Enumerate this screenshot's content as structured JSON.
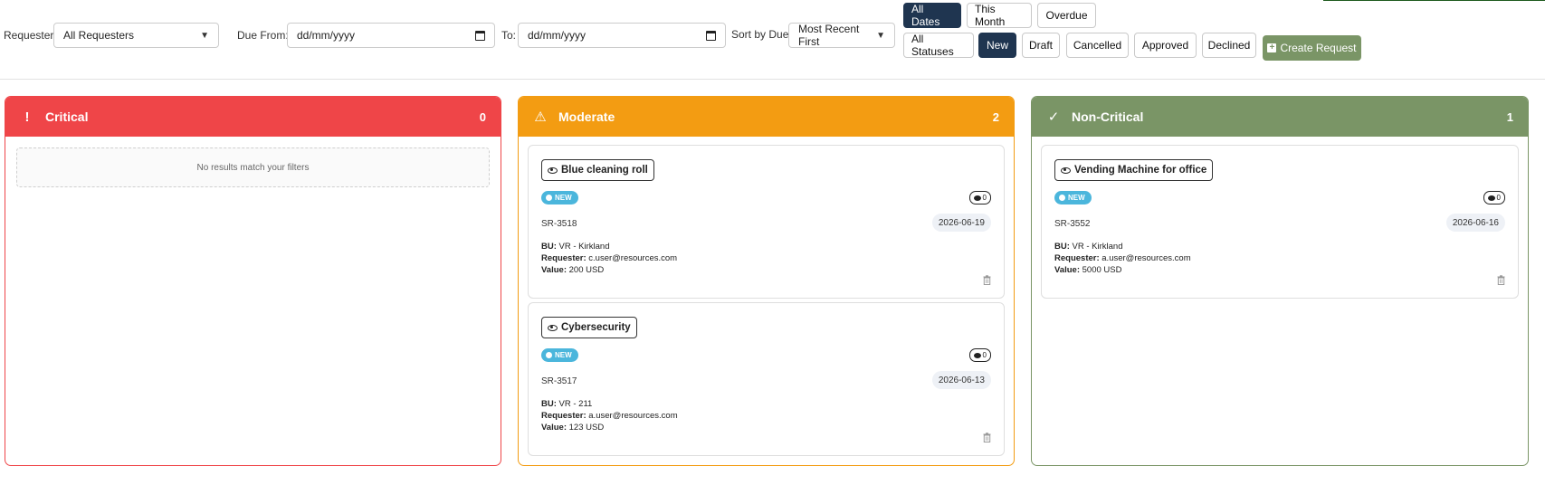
{
  "filters": {
    "requester_label": "Requester:",
    "requester_value": "All Requesters",
    "due_from_label": "Due From:",
    "due_from_placeholder": "dd/mm/yyyy",
    "to_label": "To:",
    "to_placeholder": "dd/mm/yyyy",
    "sort_label": "Sort by Due:",
    "sort_value": "Most Recent First"
  },
  "date_filters": [
    {
      "label": "All Dates",
      "active": true
    },
    {
      "label": "This Month",
      "active": false
    },
    {
      "label": "Overdue",
      "active": false
    }
  ],
  "status_filters": [
    {
      "label": "All Statuses",
      "active": false
    },
    {
      "label": "New",
      "active": true
    },
    {
      "label": "Draft",
      "active": false
    },
    {
      "label": "Cancelled",
      "active": false
    },
    {
      "label": "Approved",
      "active": false
    },
    {
      "label": "Declined",
      "active": false
    }
  ],
  "create_button": "Create Request",
  "columns": [
    {
      "title": "Critical",
      "count": "0",
      "color": "#ef4548",
      "icon": "exclamation-icon",
      "empty_text": "No results match your filters",
      "cards": []
    },
    {
      "title": "Moderate",
      "count": "2",
      "color": "#f39c12",
      "icon": "warning-icon",
      "cards": [
        {
          "title": "Blue cleaning roll",
          "status": "NEW",
          "comments": "0",
          "code": "SR-3518",
          "date": "2026-06-19",
          "bu_label": "BU:",
          "bu": "VR - Kirkland",
          "requester_label": "Requester:",
          "requester": "c.user@resources.com",
          "value_label": "Value:",
          "value": "200 USD"
        },
        {
          "title": "Cybersecurity",
          "status": "NEW",
          "comments": "0",
          "code": "SR-3517",
          "date": "2026-06-13",
          "bu_label": "BU:",
          "bu": "VR - 211",
          "requester_label": "Requester:",
          "requester": "a.user@resources.com",
          "value_label": "Value:",
          "value": "123 USD"
        }
      ]
    },
    {
      "title": "Non-Critical",
      "count": "1",
      "color": "#7a9566",
      "icon": "check-icon",
      "cards": [
        {
          "title": "Vending Machine for office",
          "status": "NEW",
          "comments": "0",
          "code": "SR-3552",
          "date": "2026-06-16",
          "bu_label": "BU:",
          "bu": "VR - Kirkland",
          "requester_label": "Requester:",
          "requester": "a.user@resources.com",
          "value_label": "Value:",
          "value": "5000 USD"
        }
      ]
    }
  ]
}
